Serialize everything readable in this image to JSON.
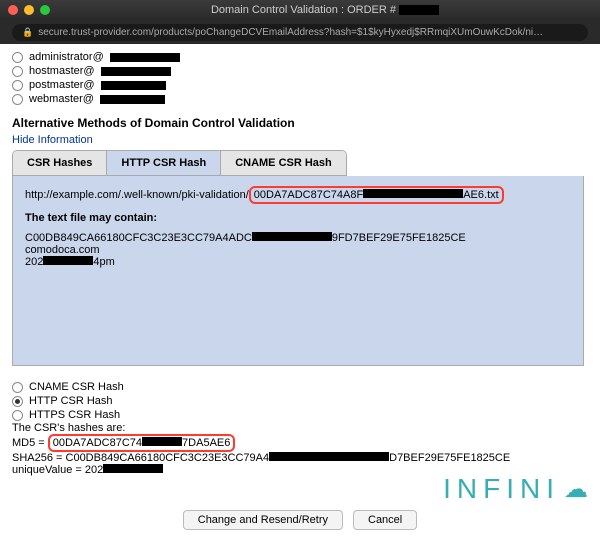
{
  "window": {
    "title": "Domain Control Validation : ORDER #",
    "url_display": "secure.trust-provider.com/products/poChangeDCVEmailAddress?hash=$1$kyHyxedj$RRmqiXUmOuwKcDok/ni…"
  },
  "top_radios": [
    {
      "label_prefix": "administrator@",
      "blur_width": 70
    },
    {
      "label_prefix": "hostmaster@",
      "blur_width": 70
    },
    {
      "label_prefix": "postmaster@",
      "blur_width": 65
    },
    {
      "label_prefix": "webmaster@",
      "blur_width": 65
    }
  ],
  "alt_heading": "Alternative Methods of Domain Control Validation",
  "hide_link": "Hide Information",
  "tabs": [
    {
      "label": "CSR Hashes",
      "active": false
    },
    {
      "label": "HTTP CSR Hash",
      "active": true
    },
    {
      "label": "CNAME CSR Hash",
      "active": false
    }
  ],
  "panel": {
    "url_prefix": "http://example.com/.well-known/pki-validation/",
    "file_boxed": "00DA7ADC87C74A8F",
    "file_tail": "AE6.txt",
    "may_contain": "The text file may contain:",
    "line1_a": "C00DB849CA66180CFC3C23E3CC79A4ADC",
    "line1_b": "9FD7BEF29E75FE1825CE",
    "line2": "comodoca.com",
    "line3_a": "202",
    "line3_b": "4pm"
  },
  "lower_radios": [
    {
      "label": "CNAME CSR Hash",
      "selected": false
    },
    {
      "label": "HTTP CSR Hash",
      "selected": true
    },
    {
      "label": "HTTPS CSR Hash",
      "selected": false
    }
  ],
  "hashes": {
    "heading": "The CSR's hashes are:",
    "md5_label": "MD5 = ",
    "md5_boxed_a": "00DA7ADC87C74",
    "md5_boxed_b": "7DA5AE6",
    "sha_label": "SHA256 = C00DB849CA66180CFC3C23E3CC79A4",
    "sha_tail": "D7BEF29E75FE1825CE",
    "uniq_label": "uniqueValue = 202"
  },
  "buttons": {
    "change": "Change and Resend/Retry",
    "cancel": "Cancel"
  },
  "watermark": "INFINI"
}
